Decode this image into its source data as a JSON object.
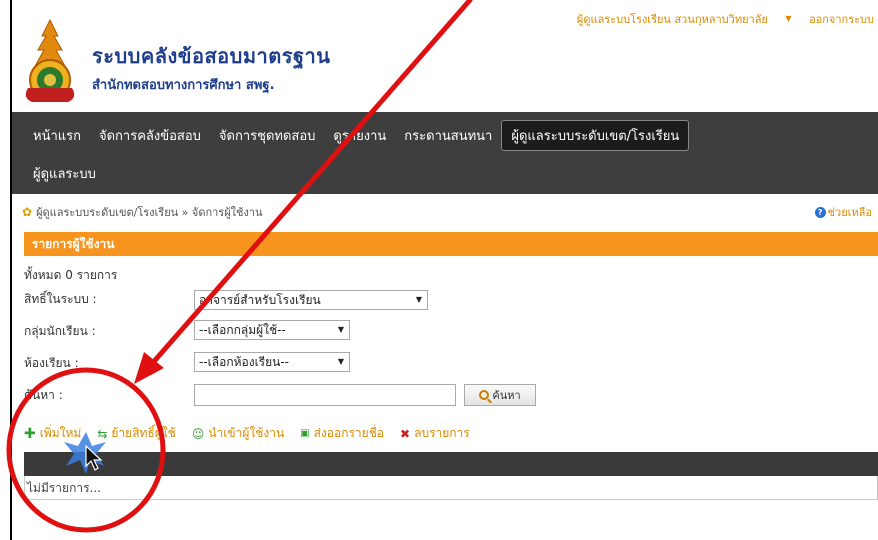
{
  "header": {
    "title": "ระบบคลังข้อสอบมาตรฐาน",
    "subtitle": "สำนักทดสอบทางการศึกษา สพฐ.",
    "user_menu": "ผู้ดูแลระบบโรงเรียน สวนกุหลาบวิทยาลัย",
    "logout": "ออกจากระบบ"
  },
  "nav": {
    "items": [
      {
        "label": "หน้าแรก"
      },
      {
        "label": "จัดการคลังข้อสอบ"
      },
      {
        "label": "จัดการชุดทดสอบ"
      },
      {
        "label": "ดูรายงาน"
      },
      {
        "label": "กระดานสนทนา"
      },
      {
        "label": "ผู้ดูแลระบบระดับเขต/โรงเรียน"
      },
      {
        "label": "ผู้ดูแลระบบ"
      }
    ]
  },
  "breadcrumb": {
    "text": "ผู้ดูแลระบบระดับเขต/โรงเรียน » จัดการผู้ใช้งาน",
    "help": "ช่วยเหลือ"
  },
  "panel": {
    "title": "รายการผู้ใช้งาน",
    "count": "ทั้งหมด 0 รายการ"
  },
  "form": {
    "role_label": "สิทธิ์ในระบบ :",
    "role_value": "อาจารย์สำหรับโรงเรียน",
    "group_label": "กลุ่มนักเรียน :",
    "group_value": "--เลือกกลุ่มผู้ใช้--",
    "room_label": "ห้องเรียน :",
    "room_value": "--เลือกห้องเรียน--",
    "search_label": "ค้นหา :",
    "search_value": "",
    "search_button": "ค้นหา"
  },
  "actions": {
    "add": "เพิ่มใหม่",
    "move": "ย้ายสิทธิ์ผู้ใช้",
    "import": "นำเข้าผู้ใช้งาน",
    "export": "ส่งออกรายชื่อ",
    "delete": "ลบรายการ"
  },
  "table": {
    "empty": "ไม่มีรายการ..."
  },
  "colors": {
    "nav_bg": "#3e3e3e",
    "accent_orange": "#f7941d",
    "title_blue": "#1f3e8c",
    "annotation_red": "#e01010"
  }
}
